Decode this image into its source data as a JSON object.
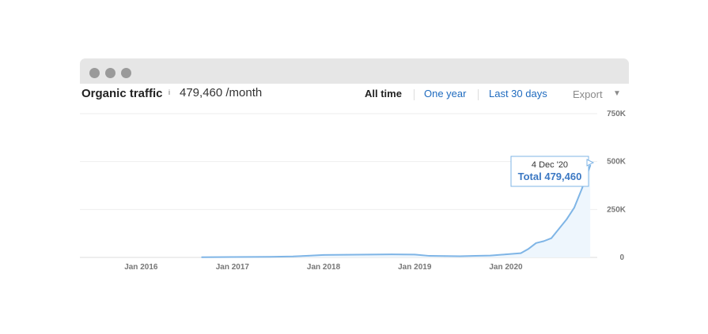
{
  "header": {
    "metric_title": "Organic traffic",
    "info_icon": "i",
    "metric_value": "479,460 /month",
    "range_tabs": [
      {
        "label": "All time",
        "active": true
      },
      {
        "label": "One year",
        "active": false
      },
      {
        "label": "Last 30 days",
        "active": false
      }
    ],
    "export_label": "Export",
    "export_chevron": "▼"
  },
  "tooltip": {
    "date": "4 Dec '20",
    "total": "Total 479,460"
  },
  "colors": {
    "line": "#7fb5e6",
    "area": "#eef6fd",
    "grid": "#eeeeee",
    "baseline": "#dddddd",
    "accent": "#3b78c3"
  },
  "icons": {
    "window_dots": "window-dot-icon",
    "info": "info-icon",
    "export_chevron": "chevron-down-icon"
  },
  "chart_data": {
    "type": "area",
    "title": "",
    "xlabel": "",
    "ylabel": "",
    "x_ticks": [
      "Jan 2016",
      "Jan 2017",
      "Jan 2018",
      "Jan 2019",
      "Jan 2020"
    ],
    "y_ticks": [
      "0",
      "250K",
      "500K",
      "750K"
    ],
    "y_tick_values": [
      0,
      250000,
      500000,
      750000
    ],
    "ylim": [
      0,
      750000
    ],
    "xlim": [
      "2015-05-01",
      "2021-01-01"
    ],
    "grid": true,
    "legend": "none",
    "series": [
      {
        "x": [
          "2016-09-01",
          "2017-01-01",
          "2017-06-01",
          "2017-09-01",
          "2017-11-01",
          "2018-01-01",
          "2018-04-01",
          "2018-07-01",
          "2018-10-01",
          "2019-01-01",
          "2019-03-01",
          "2019-05-01",
          "2019-07-01",
          "2019-09-01",
          "2019-11-01",
          "2020-01-01",
          "2020-03-01",
          "2020-04-01",
          "2020-05-01",
          "2020-06-01",
          "2020-07-01",
          "2020-08-01",
          "2020-09-01",
          "2020-10-01",
          "2020-11-01",
          "2020-12-04"
        ],
        "values": [
          1000,
          2000,
          3000,
          5000,
          9000,
          13000,
          14000,
          15000,
          16000,
          15000,
          8000,
          7000,
          6000,
          8000,
          10000,
          16000,
          22000,
          45000,
          75000,
          85000,
          100000,
          150000,
          200000,
          260000,
          360000,
          479460
        ]
      }
    ]
  }
}
